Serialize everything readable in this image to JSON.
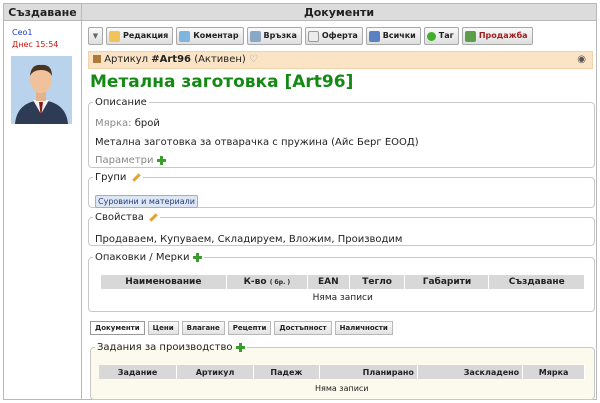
{
  "headers": {
    "created": "Създаване",
    "documents": "Документи"
  },
  "user": {
    "name": "Ceo1",
    "time": "Днес 15:54"
  },
  "toolbar": {
    "edit": "Редакция",
    "comment": "Коментар",
    "link": "Връзка",
    "offer": "Оферта",
    "all": "Всички",
    "tag": "Таг",
    "sale": "Продажба"
  },
  "article": {
    "prefix": "Артикул",
    "code": "#Art96",
    "status": "(Активен)",
    "title": "Метална заготовка [Art96]"
  },
  "description": {
    "legend": "Описание",
    "measure_label": "Мярка:",
    "measure_value": "брой",
    "text": "Метална заготовка за отварачка с пружина (Айс Берг ЕООД)",
    "params": "Параметри"
  },
  "groups": {
    "legend": "Групи",
    "tag": "Суровини и материали"
  },
  "properties": {
    "legend": "Свойства",
    "text": "Продаваем, Купуваем, Складируем, Вложим, Производим"
  },
  "packages": {
    "legend": "Опаковки / Мерки",
    "columns": [
      "Наименование",
      "К-во",
      "EAN",
      "Тегло",
      "Габарити",
      "Създаване"
    ],
    "qty_unit": "( бр. )",
    "empty": "Няма записи"
  },
  "tabs": [
    "Документи",
    "Цени",
    "Влагане",
    "Рецепти",
    "Достъпност",
    "Наличности"
  ],
  "production": {
    "legend": "Задания за производство",
    "columns": [
      "Задание",
      "Артикул",
      "Падеж",
      "Планирано",
      "Заскладено",
      "Мярка"
    ],
    "empty": "Няма записи"
  }
}
